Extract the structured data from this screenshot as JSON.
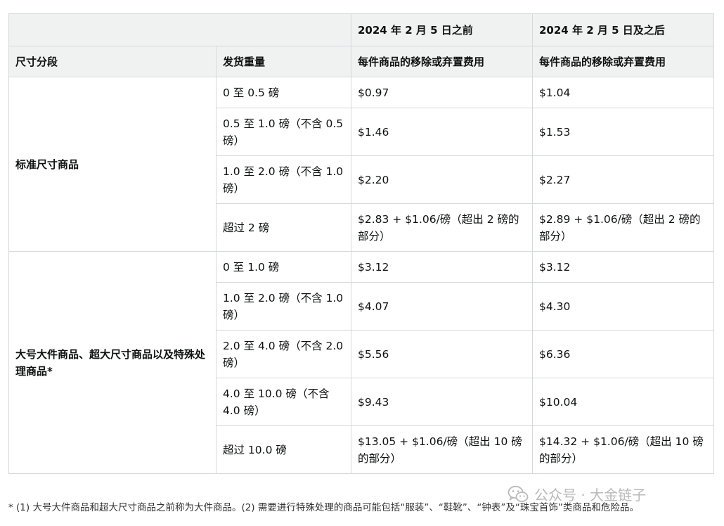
{
  "table": {
    "header_top": {
      "empty": "",
      "before_period": "2024 年 2 月 5 日之前",
      "after_period": "2024 年 2 月 5 日及之后"
    },
    "header_sub": {
      "size_tier": "尺寸分段",
      "shipping_weight": "发货重量",
      "fee_before": "每件商品的移除或弃置费用",
      "fee_after": "每件商品的移除或弃置费用"
    },
    "groups": [
      {
        "tier": "标准尺寸商品",
        "rows": [
          {
            "weight": "0 至 0.5 磅",
            "before": "$0.97",
            "after": "$1.04"
          },
          {
            "weight": "0.5 至 1.0 磅（不含 0.5 磅）",
            "before": "$1.46",
            "after": "$1.53"
          },
          {
            "weight": "1.0 至 2.0 磅（不含 1.0 磅）",
            "before": "$2.20",
            "after": "$2.27"
          },
          {
            "weight": "超过 2 磅",
            "before": "$2.83 + $1.06/磅（超出 2 磅的部分）",
            "after": "$2.89 + $1.06/磅（超出 2 磅的部分）"
          }
        ]
      },
      {
        "tier": "大号大件商品、超大尺寸商品以及特殊处理商品*",
        "rows": [
          {
            "weight": "0 至 1.0 磅",
            "before": "$3.12",
            "after": "$3.12"
          },
          {
            "weight": "1.0 至 2.0 磅（不含 1.0 磅）",
            "before": "$4.07",
            "after": "$4.30"
          },
          {
            "weight": "2.0 至 4.0 磅（不含 2.0 磅）",
            "before": "$5.56",
            "after": "$6.36"
          },
          {
            "weight": "4.0 至 10.0 磅（不含 4.0 磅）",
            "before": "$9.43",
            "after": "$10.04"
          },
          {
            "weight": "超过 10.0 磅",
            "before": "$13.05 + $1.06/磅（超出 10 磅的部分）",
            "after": "$14.32 + $1.06/磅（超出 10 磅的部分）"
          }
        ]
      }
    ]
  },
  "footnote": "* (1) 大号大件商品和超大尺寸商品之前称为大件商品。(2) 需要进行特殊处理的商品可能包括“服装”、“鞋靴”、“钟表”及“珠宝首饰”类商品和危险品。",
  "watermark": {
    "icon": "wechat-icon",
    "text": "公众号 · 大金链子"
  }
}
